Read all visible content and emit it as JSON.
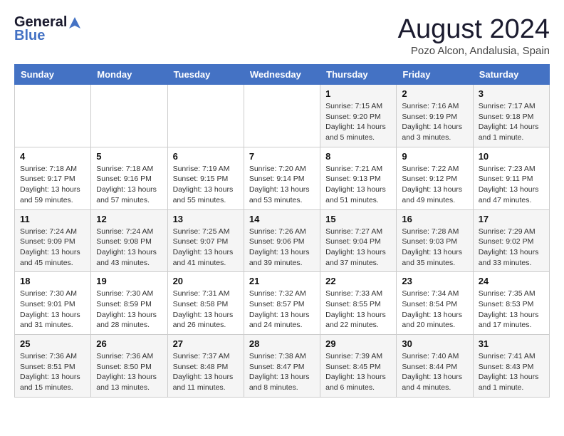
{
  "header": {
    "logo_general": "General",
    "logo_blue": "Blue",
    "title": "August 2024",
    "location": "Pozo Alcon, Andalusia, Spain"
  },
  "days_of_week": [
    "Sunday",
    "Monday",
    "Tuesday",
    "Wednesday",
    "Thursday",
    "Friday",
    "Saturday"
  ],
  "weeks": [
    [
      {
        "day": "",
        "info": ""
      },
      {
        "day": "",
        "info": ""
      },
      {
        "day": "",
        "info": ""
      },
      {
        "day": "",
        "info": ""
      },
      {
        "day": "1",
        "info": "Sunrise: 7:15 AM\nSunset: 9:20 PM\nDaylight: 14 hours\nand 5 minutes."
      },
      {
        "day": "2",
        "info": "Sunrise: 7:16 AM\nSunset: 9:19 PM\nDaylight: 14 hours\nand 3 minutes."
      },
      {
        "day": "3",
        "info": "Sunrise: 7:17 AM\nSunset: 9:18 PM\nDaylight: 14 hours\nand 1 minute."
      }
    ],
    [
      {
        "day": "4",
        "info": "Sunrise: 7:18 AM\nSunset: 9:17 PM\nDaylight: 13 hours\nand 59 minutes."
      },
      {
        "day": "5",
        "info": "Sunrise: 7:18 AM\nSunset: 9:16 PM\nDaylight: 13 hours\nand 57 minutes."
      },
      {
        "day": "6",
        "info": "Sunrise: 7:19 AM\nSunset: 9:15 PM\nDaylight: 13 hours\nand 55 minutes."
      },
      {
        "day": "7",
        "info": "Sunrise: 7:20 AM\nSunset: 9:14 PM\nDaylight: 13 hours\nand 53 minutes."
      },
      {
        "day": "8",
        "info": "Sunrise: 7:21 AM\nSunset: 9:13 PM\nDaylight: 13 hours\nand 51 minutes."
      },
      {
        "day": "9",
        "info": "Sunrise: 7:22 AM\nSunset: 9:12 PM\nDaylight: 13 hours\nand 49 minutes."
      },
      {
        "day": "10",
        "info": "Sunrise: 7:23 AM\nSunset: 9:11 PM\nDaylight: 13 hours\nand 47 minutes."
      }
    ],
    [
      {
        "day": "11",
        "info": "Sunrise: 7:24 AM\nSunset: 9:09 PM\nDaylight: 13 hours\nand 45 minutes."
      },
      {
        "day": "12",
        "info": "Sunrise: 7:24 AM\nSunset: 9:08 PM\nDaylight: 13 hours\nand 43 minutes."
      },
      {
        "day": "13",
        "info": "Sunrise: 7:25 AM\nSunset: 9:07 PM\nDaylight: 13 hours\nand 41 minutes."
      },
      {
        "day": "14",
        "info": "Sunrise: 7:26 AM\nSunset: 9:06 PM\nDaylight: 13 hours\nand 39 minutes."
      },
      {
        "day": "15",
        "info": "Sunrise: 7:27 AM\nSunset: 9:04 PM\nDaylight: 13 hours\nand 37 minutes."
      },
      {
        "day": "16",
        "info": "Sunrise: 7:28 AM\nSunset: 9:03 PM\nDaylight: 13 hours\nand 35 minutes."
      },
      {
        "day": "17",
        "info": "Sunrise: 7:29 AM\nSunset: 9:02 PM\nDaylight: 13 hours\nand 33 minutes."
      }
    ],
    [
      {
        "day": "18",
        "info": "Sunrise: 7:30 AM\nSunset: 9:01 PM\nDaylight: 13 hours\nand 31 minutes."
      },
      {
        "day": "19",
        "info": "Sunrise: 7:30 AM\nSunset: 8:59 PM\nDaylight: 13 hours\nand 28 minutes."
      },
      {
        "day": "20",
        "info": "Sunrise: 7:31 AM\nSunset: 8:58 PM\nDaylight: 13 hours\nand 26 minutes."
      },
      {
        "day": "21",
        "info": "Sunrise: 7:32 AM\nSunset: 8:57 PM\nDaylight: 13 hours\nand 24 minutes."
      },
      {
        "day": "22",
        "info": "Sunrise: 7:33 AM\nSunset: 8:55 PM\nDaylight: 13 hours\nand 22 minutes."
      },
      {
        "day": "23",
        "info": "Sunrise: 7:34 AM\nSunset: 8:54 PM\nDaylight: 13 hours\nand 20 minutes."
      },
      {
        "day": "24",
        "info": "Sunrise: 7:35 AM\nSunset: 8:53 PM\nDaylight: 13 hours\nand 17 minutes."
      }
    ],
    [
      {
        "day": "25",
        "info": "Sunrise: 7:36 AM\nSunset: 8:51 PM\nDaylight: 13 hours\nand 15 minutes."
      },
      {
        "day": "26",
        "info": "Sunrise: 7:36 AM\nSunset: 8:50 PM\nDaylight: 13 hours\nand 13 minutes."
      },
      {
        "day": "27",
        "info": "Sunrise: 7:37 AM\nSunset: 8:48 PM\nDaylight: 13 hours\nand 11 minutes."
      },
      {
        "day": "28",
        "info": "Sunrise: 7:38 AM\nSunset: 8:47 PM\nDaylight: 13 hours\nand 8 minutes."
      },
      {
        "day": "29",
        "info": "Sunrise: 7:39 AM\nSunset: 8:45 PM\nDaylight: 13 hours\nand 6 minutes."
      },
      {
        "day": "30",
        "info": "Sunrise: 7:40 AM\nSunset: 8:44 PM\nDaylight: 13 hours\nand 4 minutes."
      },
      {
        "day": "31",
        "info": "Sunrise: 7:41 AM\nSunset: 8:43 PM\nDaylight: 13 hours\nand 1 minute."
      }
    ]
  ]
}
